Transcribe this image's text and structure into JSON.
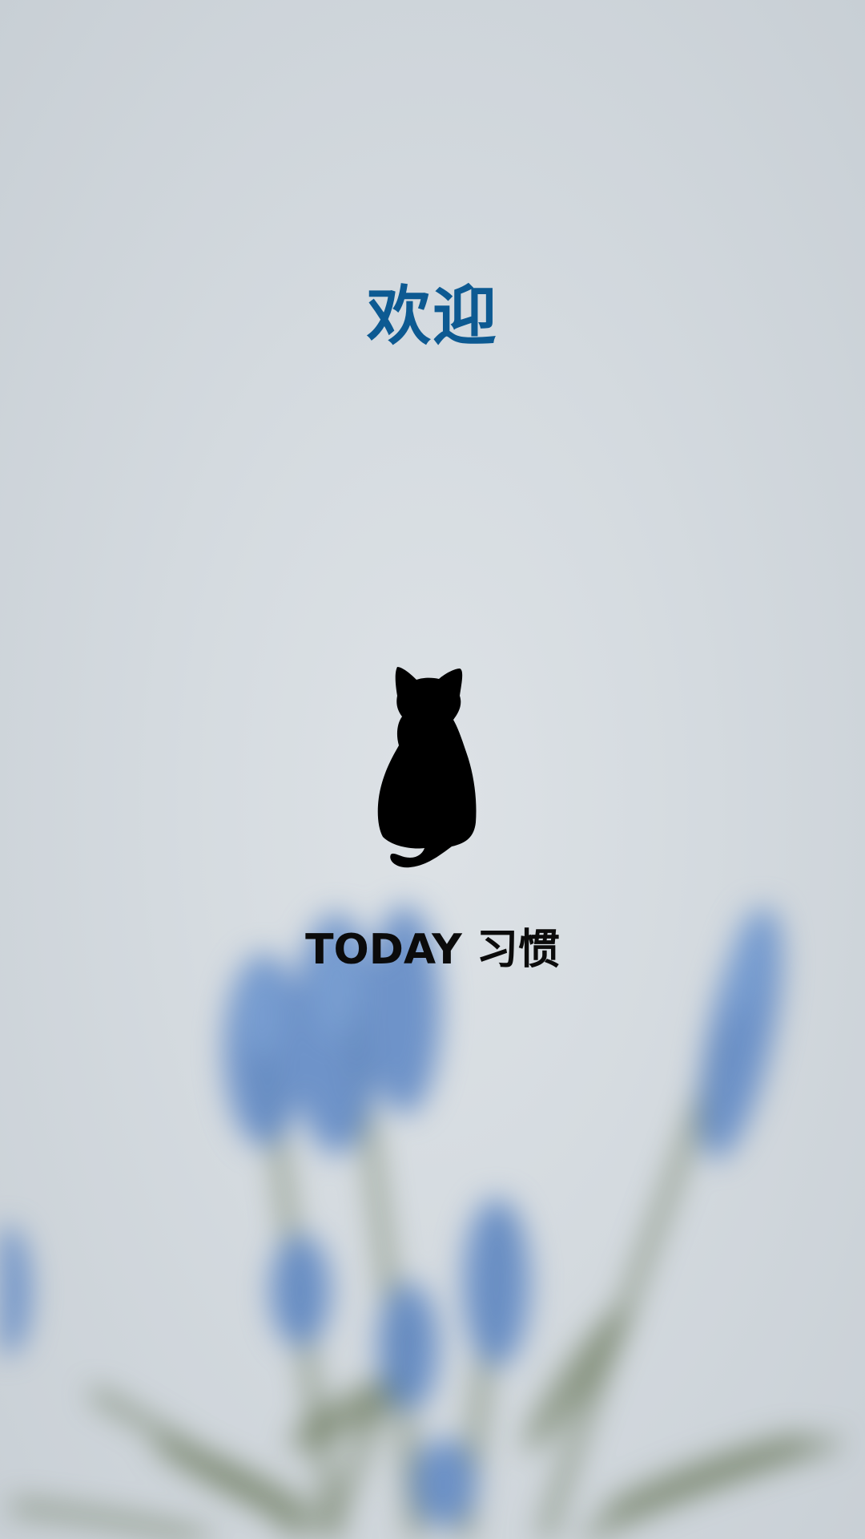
{
  "splash": {
    "welcome_text": "欢迎",
    "app_name": "TODAY 习惯"
  },
  "icons": {
    "logo": "cat-silhouette-icon"
  },
  "colors": {
    "welcome_text": "#0d5a92",
    "app_name": "#0b0b0b",
    "background": "#d6dce1",
    "flower_blue": "#5b86c4",
    "stem_green": "#5f6e4e"
  }
}
